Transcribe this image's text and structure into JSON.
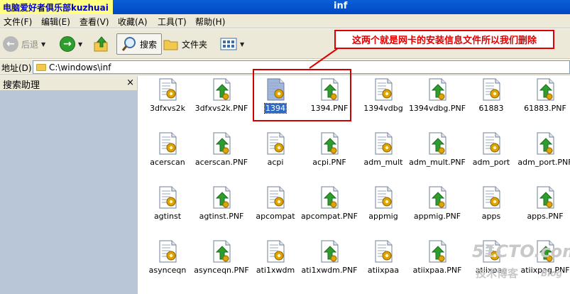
{
  "titlebar": {
    "tag": "电脑爱好者俱乐部kuzhuai",
    "title": "inf"
  },
  "menu": [
    "文件(F)",
    "编辑(E)",
    "查看(V)",
    "收藏(A)",
    "工具(T)",
    "帮助(H)"
  ],
  "toolbar": {
    "back_label": "后退",
    "search_label": "搜索",
    "folders_label": "文件夹"
  },
  "callout": {
    "text": "这两个就是网卡的安装信息文件所以我们删除"
  },
  "address": {
    "label": "地址(D)",
    "path": "C:\\windows\\inf"
  },
  "left_pane": {
    "title": "搜索助理",
    "close": "×"
  },
  "files": [
    {
      "label": "3dfxvs2k",
      "kind": "inf"
    },
    {
      "label": "3dfxvs2k.PNF",
      "kind": "pnf"
    },
    {
      "label": "1394",
      "kind": "inf",
      "selected": true
    },
    {
      "label": "1394.PNF",
      "kind": "pnf"
    },
    {
      "label": "1394vdbg",
      "kind": "inf"
    },
    {
      "label": "1394vdbg.PNF",
      "kind": "pnf"
    },
    {
      "label": "61883",
      "kind": "inf"
    },
    {
      "label": "61883.PNF",
      "kind": "pnf"
    },
    {
      "label": "acerscan",
      "kind": "inf"
    },
    {
      "label": "acerscan.PNF",
      "kind": "pnf"
    },
    {
      "label": "acpi",
      "kind": "inf"
    },
    {
      "label": "acpi.PNF",
      "kind": "pnf"
    },
    {
      "label": "adm_mult",
      "kind": "inf"
    },
    {
      "label": "adm_mult.PNF",
      "kind": "pnf"
    },
    {
      "label": "adm_port",
      "kind": "inf"
    },
    {
      "label": "adm_port.PNF",
      "kind": "pnf"
    },
    {
      "label": "agtinst",
      "kind": "inf"
    },
    {
      "label": "agtinst.PNF",
      "kind": "pnf"
    },
    {
      "label": "apcompat",
      "kind": "inf"
    },
    {
      "label": "apcompat.PNF",
      "kind": "pnf"
    },
    {
      "label": "appmig",
      "kind": "inf"
    },
    {
      "label": "appmig.PNF",
      "kind": "pnf"
    },
    {
      "label": "apps",
      "kind": "inf"
    },
    {
      "label": "apps.PNF",
      "kind": "pnf"
    },
    {
      "label": "asynceqn",
      "kind": "inf"
    },
    {
      "label": "asynceqn.PNF",
      "kind": "pnf"
    },
    {
      "label": "ati1xwdm",
      "kind": "inf"
    },
    {
      "label": "ati1xwdm.PNF",
      "kind": "pnf"
    },
    {
      "label": "atiixpaa",
      "kind": "inf"
    },
    {
      "label": "atiixpaa.PNF",
      "kind": "pnf"
    },
    {
      "label": "atiixpag",
      "kind": "inf"
    },
    {
      "label": "atiixpag.PNF",
      "kind": "pnf"
    }
  ],
  "watermark": {
    "line1": "51CTO.com",
    "line2": "技术博客",
    "line3": "Blog"
  },
  "colors": {
    "titlebar": "#0a5fd8",
    "callout": "#e00000",
    "selection": "#316ac5"
  }
}
